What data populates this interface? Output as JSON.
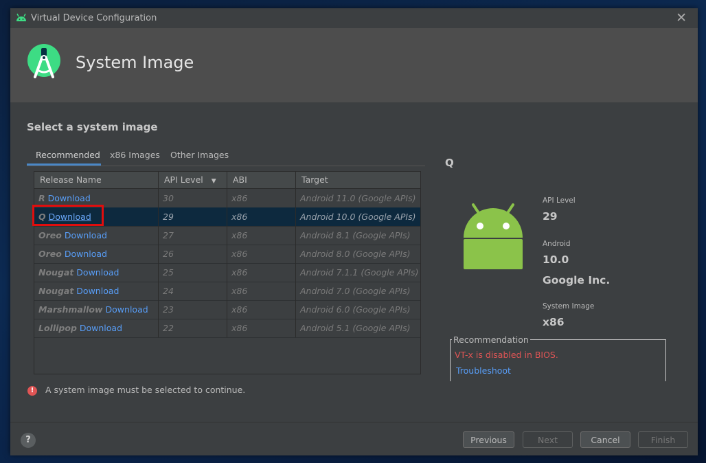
{
  "window": {
    "title": "Virtual Device Configuration"
  },
  "banner": {
    "title": "System Image"
  },
  "page": {
    "subtitle": "Select a system image",
    "tabs": [
      {
        "label": "Recommended",
        "active": true
      },
      {
        "label": "x86 Images",
        "active": false
      },
      {
        "label": "Other Images",
        "active": false
      }
    ]
  },
  "table": {
    "columns": [
      "Release Name",
      "API Level",
      "ABI",
      "Target"
    ],
    "sort_icon": "sort-down-triangle-icon",
    "rows": [
      {
        "release": "R",
        "link": "Download",
        "api": "30",
        "abi": "x86",
        "target": "Android 11.0 (Google APIs)"
      },
      {
        "release": "Q",
        "link": "Download",
        "api": "29",
        "abi": "x86",
        "target": "Android 10.0 (Google APIs)"
      },
      {
        "release": "Oreo",
        "link": "Download",
        "api": "27",
        "abi": "x86",
        "target": "Android 8.1 (Google APIs)"
      },
      {
        "release": "Oreo",
        "link": "Download",
        "api": "26",
        "abi": "x86",
        "target": "Android 8.0 (Google APIs)"
      },
      {
        "release": "Nougat",
        "link": "Download",
        "api": "25",
        "abi": "x86",
        "target": "Android 7.1.1 (Google APIs)"
      },
      {
        "release": "Nougat",
        "link": "Download",
        "api": "24",
        "abi": "x86",
        "target": "Android 7.0 (Google APIs)"
      },
      {
        "release": "Marshmallow",
        "link": "Download",
        "api": "23",
        "abi": "x86",
        "target": "Android 6.0 (Google APIs)"
      },
      {
        "release": "Lollipop",
        "link": "Download",
        "api": "22",
        "abi": "x86",
        "target": "Android 5.1 (Google APIs)"
      }
    ],
    "selected_index": 1
  },
  "error": {
    "message": "A system image must be selected to continue."
  },
  "details": {
    "code": "Q",
    "api_label": "API Level",
    "api_value": "29",
    "android_label": "Android",
    "android_value": "10.0",
    "vendor": "Google Inc.",
    "sysimg_label": "System Image",
    "sysimg_value": "x86",
    "recommendation_title": "Recommendation",
    "recommendation_warning": "VT-x is disabled in BIOS.",
    "troubleshoot_link": "Troubleshoot"
  },
  "footer": {
    "help": "?",
    "previous": "Previous",
    "next": "Next",
    "cancel": "Cancel",
    "finish": "Finish"
  },
  "colors": {
    "accent": "#4a88c7",
    "link": "#589df6",
    "error": "#e05555",
    "android_green": "#8bc34a",
    "highlight_box": "#e00d0d"
  }
}
